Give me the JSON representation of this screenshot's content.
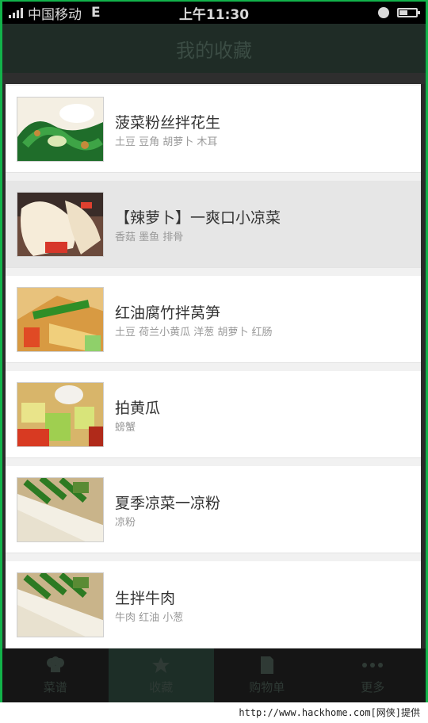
{
  "status_bar": {
    "carrier": "中国移动",
    "network": "E",
    "time": "上午11:30"
  },
  "header": {
    "title": "我的收藏"
  },
  "favorites": [
    {
      "title": "菠菜粉丝拌花生",
      "tags": "土豆  豆角  胡萝卜  木耳",
      "thumb": "spinach-salad"
    },
    {
      "title": "【辣萝卜】一爽口小凉菜",
      "tags": "香菇  墨鱼  排骨",
      "thumb": "radish-salad"
    },
    {
      "title": "红油腐竹拌莴笋",
      "tags": "土豆  荷兰小黄瓜  洋葱  胡萝卜  红肠",
      "thumb": "tofu-skin-salad"
    },
    {
      "title": "拍黄瓜",
      "tags": "螃蟹",
      "thumb": "cucumber-salad"
    },
    {
      "title": "夏季凉菜一凉粉",
      "tags": "凉粉",
      "thumb": "jelly-noodle"
    },
    {
      "title": "生拌牛肉",
      "tags": "牛肉  红油  小葱",
      "thumb": "beef-salad"
    }
  ],
  "tabs": [
    {
      "label": "菜谱",
      "icon": "chef-hat-icon"
    },
    {
      "label": "收藏",
      "icon": "star-icon",
      "active": true
    },
    {
      "label": "购物单",
      "icon": "shopping-list-icon"
    },
    {
      "label": "更多",
      "icon": "more-dots-icon"
    }
  ],
  "footer": {
    "watermark": "http://www.hackhome.com[网侠]提供"
  }
}
